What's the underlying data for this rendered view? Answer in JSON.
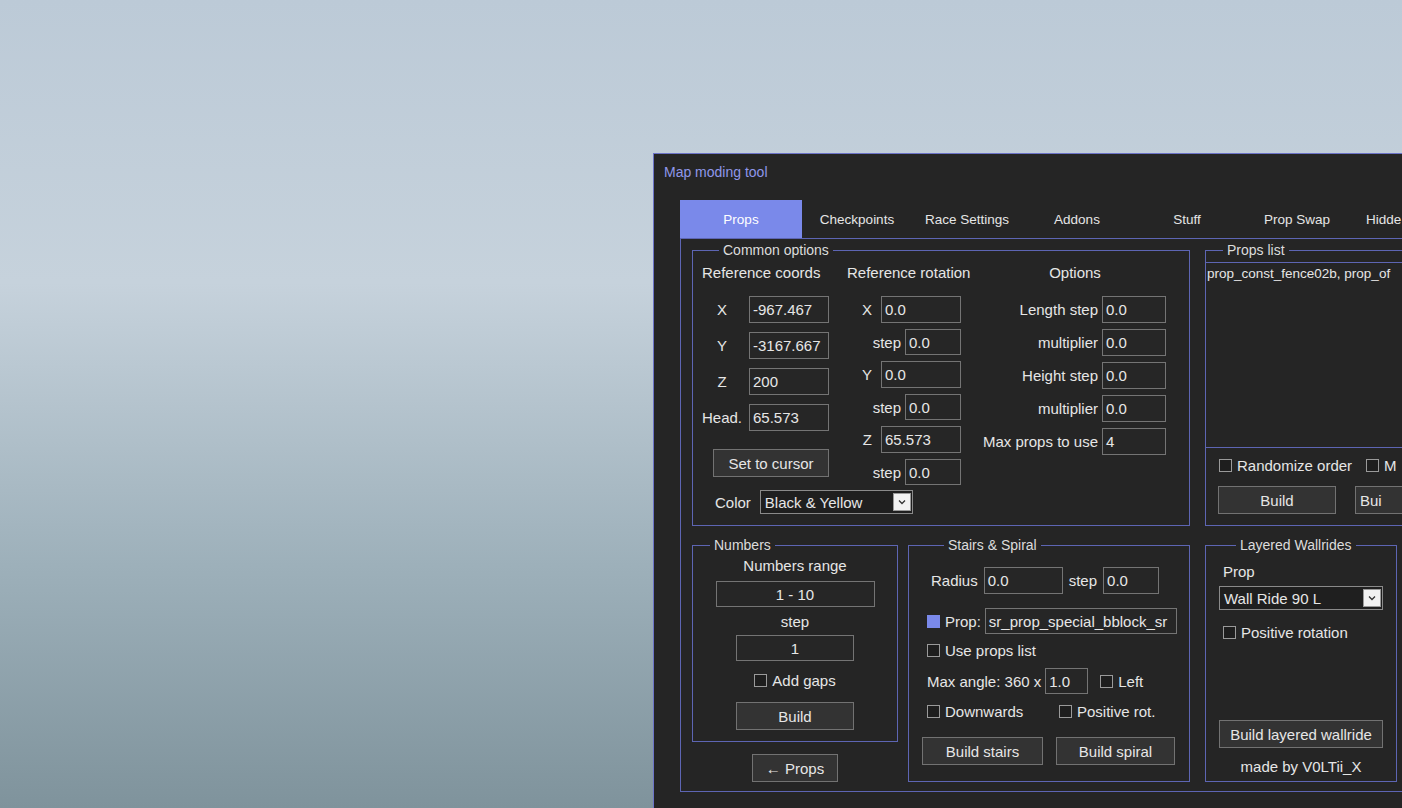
{
  "window": {
    "title": "Map moding tool"
  },
  "tabs": [
    {
      "label": "Props",
      "selected": true
    },
    {
      "label": "Checkpoints",
      "selected": false
    },
    {
      "label": "Race Settings",
      "selected": false
    },
    {
      "label": "Addons",
      "selected": false
    },
    {
      "label": "Stuff",
      "selected": false
    },
    {
      "label": "Prop Swap",
      "selected": false
    },
    {
      "label": "Hidde",
      "selected": false
    }
  ],
  "common_options": {
    "title": "Common options",
    "reference_coords": {
      "title": "Reference coords",
      "fields": [
        {
          "label": "X",
          "value": "-967.467"
        },
        {
          "label": "Y",
          "value": "-3167.667"
        },
        {
          "label": "Z",
          "value": "200"
        },
        {
          "label": "Head.",
          "value": "65.573"
        }
      ],
      "button": "Set to cursor"
    },
    "reference_rotation": {
      "title": "Reference rotation",
      "fields": [
        {
          "label": "X",
          "value": "0.0",
          "kind": "axis"
        },
        {
          "label": "step",
          "value": "0.0",
          "kind": "step"
        },
        {
          "label": "Y",
          "value": "0.0",
          "kind": "axis"
        },
        {
          "label": "step",
          "value": "0.0",
          "kind": "step"
        },
        {
          "label": "Z",
          "value": "65.573",
          "kind": "axis"
        },
        {
          "label": "step",
          "value": "0.0",
          "kind": "step"
        }
      ]
    },
    "options": {
      "title": "Options",
      "fields": [
        {
          "label": "Length step",
          "value": "0.0"
        },
        {
          "label": "multiplier",
          "value": "0.0"
        },
        {
          "label": "Height step",
          "value": "0.0"
        },
        {
          "label": "multiplier",
          "value": "0.0"
        },
        {
          "label": "Max props to use",
          "value": "4"
        }
      ]
    },
    "color": {
      "label": "Color",
      "value": "Black & Yellow"
    }
  },
  "props_list": {
    "title": "Props list",
    "items": [
      "prop_const_fence02b, prop_of"
    ],
    "options": [
      {
        "label": "Randomize order",
        "checked": false
      },
      {
        "label": "M",
        "checked": false
      }
    ],
    "buttons": [
      "Build",
      "Bui"
    ]
  },
  "numbers": {
    "title": "Numbers",
    "range_label": "Numbers range",
    "range_value": "1 - 10",
    "step_label": "step",
    "step_value": "1",
    "add_gaps": {
      "label": "Add gaps",
      "checked": false
    },
    "button": "Build"
  },
  "back_button": "← Props",
  "stairs_spiral": {
    "title": "Stairs & Spiral",
    "radius": {
      "label": "Radius",
      "value": "0.0"
    },
    "radius_step": {
      "label": "step",
      "value": "0.0"
    },
    "prop": {
      "label": "Prop:",
      "checked": true,
      "value": "sr_prop_special_bblock_sr"
    },
    "use_props_list": {
      "label": "Use props list",
      "checked": false
    },
    "max_angle": {
      "label": "Max angle: 360 x",
      "value": "1.0"
    },
    "left": {
      "label": "Left",
      "checked": false
    },
    "downwards": {
      "label": "Downwards",
      "checked": false
    },
    "positive_rot": {
      "label": "Positive rot.",
      "checked": false
    },
    "buttons": [
      "Build stairs",
      "Build spiral"
    ]
  },
  "layered_wallrides": {
    "title": "Layered Wallrides",
    "prop_label": "Prop",
    "prop_value": "Wall Ride 90 L",
    "positive_rotation": {
      "label": "Positive rotation",
      "checked": false
    },
    "button": "Build layered wallride",
    "credit": "made by V0LTii_X"
  }
}
